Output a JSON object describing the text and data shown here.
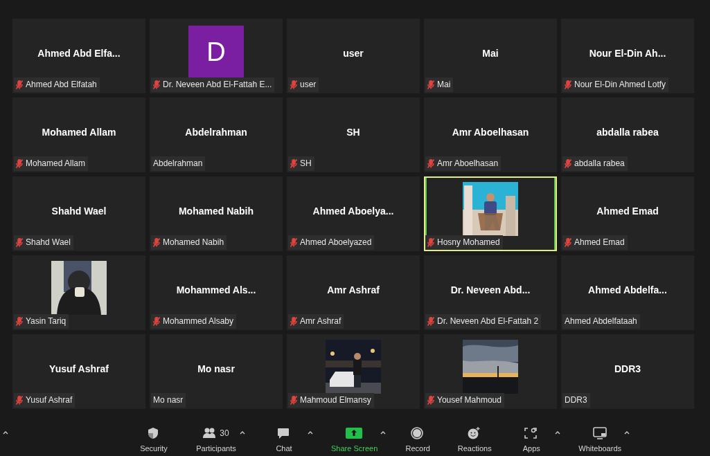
{
  "tiles": [
    {
      "kind": "name",
      "display_name": "Ahmed Abd Elfa...",
      "label": "Ahmed Abd Elfatah",
      "muted": true,
      "selected": false
    },
    {
      "kind": "avatar",
      "letter": "D",
      "color": "#7a1fa2",
      "label": "Dr. Neveen Abd El-Fattah E...",
      "muted": true,
      "selected": false
    },
    {
      "kind": "name",
      "display_name": "user",
      "label": "user",
      "muted": true,
      "selected": false
    },
    {
      "kind": "name",
      "display_name": "Mai",
      "label": "Mai",
      "muted": true,
      "selected": false
    },
    {
      "kind": "name",
      "display_name": "Nour El-Din Ah...",
      "label": "Nour El-Din Ahmed Lotfy",
      "muted": true,
      "selected": false
    },
    {
      "kind": "name",
      "display_name": "Mohamed Allam",
      "label": "Mohamed Allam",
      "muted": true,
      "selected": false
    },
    {
      "kind": "name",
      "display_name": "Abdelrahman",
      "label": "Abdelrahman",
      "muted": false,
      "selected": false
    },
    {
      "kind": "name",
      "display_name": "SH",
      "label": "SH",
      "muted": true,
      "selected": false
    },
    {
      "kind": "name",
      "display_name": "Amr Aboelhasan",
      "label": "Amr Aboelhasan",
      "muted": true,
      "selected": false
    },
    {
      "kind": "name",
      "display_name": "abdalla rabea",
      "label": "abdalla rabea",
      "muted": true,
      "selected": false
    },
    {
      "kind": "name",
      "display_name": "Shahd Wael",
      "label": "Shahd Wael",
      "muted": true,
      "selected": false
    },
    {
      "kind": "name",
      "display_name": "Mohamed Nabih",
      "label": "Mohamed Nabih",
      "muted": true,
      "selected": false
    },
    {
      "kind": "name",
      "display_name": "Ahmed  Aboelya...",
      "label": "Ahmed Aboelyazed",
      "muted": true,
      "selected": false
    },
    {
      "kind": "picture",
      "label": "Hosny Mohamed",
      "muted": true,
      "selected": true
    },
    {
      "kind": "name",
      "display_name": "Ahmed Emad",
      "label": "Ahmed Emad",
      "muted": true,
      "selected": false
    },
    {
      "kind": "picture",
      "label": "Yasin Tariq",
      "muted": true,
      "selected": false
    },
    {
      "kind": "name",
      "display_name": "Mohammed  Als...",
      "label": "Mohammed Alsaby",
      "muted": true,
      "selected": false
    },
    {
      "kind": "name",
      "display_name": "Amr Ashraf",
      "label": "Amr Ashraf",
      "muted": true,
      "selected": false
    },
    {
      "kind": "name",
      "display_name": "Dr. Neveen Abd...",
      "label": "Dr. Neveen Abd El-Fattah 2",
      "muted": true,
      "selected": false
    },
    {
      "kind": "name",
      "display_name": "Ahmed  Abdelfa...",
      "label": "Ahmed Abdelfataah",
      "muted": false,
      "selected": false
    },
    {
      "kind": "name",
      "display_name": "Yusuf Ashraf",
      "label": "Yusuf Ashraf",
      "muted": true,
      "selected": false
    },
    {
      "kind": "name",
      "display_name": "Mo nasr",
      "label": "Mo nasr",
      "muted": false,
      "selected": false
    },
    {
      "kind": "picture",
      "label": "Mahmoud Elmansy",
      "muted": true,
      "selected": false
    },
    {
      "kind": "picture",
      "label": "Yousef Mahmoud",
      "muted": true,
      "selected": false
    },
    {
      "kind": "name",
      "display_name": "DDR3",
      "label": "DDR3",
      "muted": false,
      "selected": false
    }
  ],
  "toolbar": [
    {
      "kind": "security",
      "label": "Security",
      "menu": false,
      "highlighted": false
    },
    {
      "kind": "participants",
      "label": "Participants",
      "count": "30",
      "menu": true,
      "highlighted": false
    },
    {
      "kind": "chat",
      "label": "Chat",
      "menu": true,
      "highlighted": false
    },
    {
      "kind": "share",
      "label": "Share Screen",
      "menu": true,
      "highlighted": true
    },
    {
      "kind": "record",
      "label": "Record",
      "menu": false,
      "highlighted": false
    },
    {
      "kind": "reactions",
      "label": "Reactions",
      "menu": false,
      "highlighted": false
    },
    {
      "kind": "apps",
      "label": "Apps",
      "menu": true,
      "highlighted": false
    },
    {
      "kind": "whiteboards",
      "label": "Whiteboards",
      "menu": true,
      "highlighted": false
    }
  ]
}
